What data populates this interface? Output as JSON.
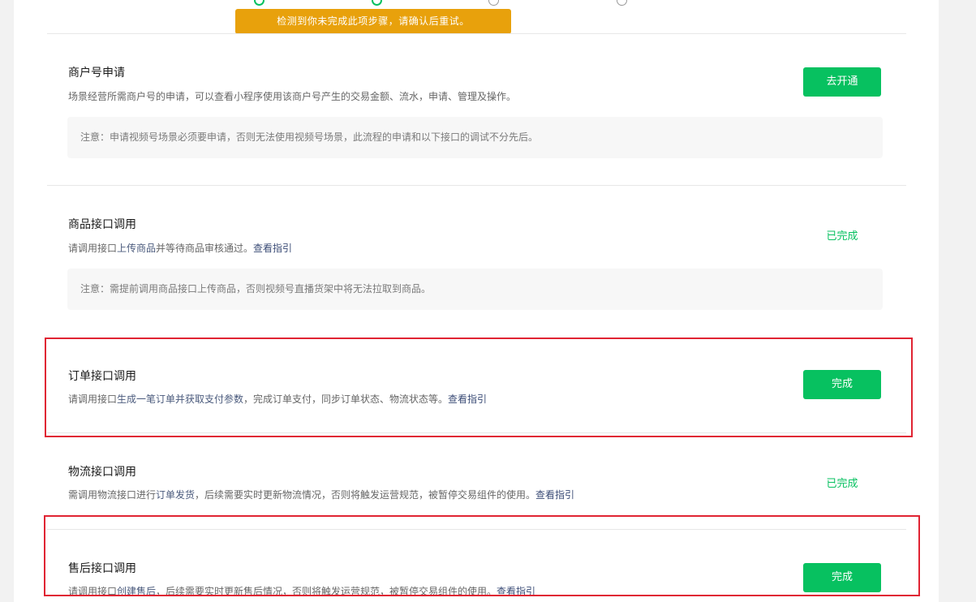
{
  "toast": {
    "message": "检测到你未完成此项步骤，请确认后重试。"
  },
  "sections": {
    "merchant": {
      "title": "商户号申请",
      "desc": "场景经营所需商户号的申请，可以查看小程序使用该商户号产生的交易金额、流水，申请、管理及操作。",
      "notice": "注意：申请视频号场景必须要申请，否则无法使用视频号场景，此流程的申请和以下接口的调试不分先后。",
      "action_label": "去开通"
    },
    "product": {
      "title": "商品接口调用",
      "desc_prefix": "请调用接口",
      "desc_keyword": "上传商品",
      "desc_suffix": "并等待商品审核通过。",
      "guide_link": "查看指引",
      "notice": "注意：需提前调用商品接口上传商品，否则视频号直播货架中将无法拉取到商品。",
      "status": "已完成"
    },
    "order": {
      "title": "订单接口调用",
      "desc_prefix": "请调用接口",
      "desc_keyword": "生成一笔订单并获取支付参数",
      "desc_suffix": "，完成订单支付，同步订单状态、物流状态等。",
      "guide_link": "查看指引",
      "action_label": "完成"
    },
    "logistics": {
      "title": "物流接口调用",
      "desc_prefix": "需调用物流接口进行",
      "desc_keyword": "订单发货",
      "desc_suffix": "，后续需要实时更新物流情况，否则将触发运营规范，被暂停交易组件的使用。",
      "guide_link": "查看指引",
      "status": "已完成"
    },
    "aftersale": {
      "title": "售后接口调用",
      "desc_prefix": "请调用接口",
      "desc_keyword": "创建售后",
      "desc_suffix": "，后续需要实时更新售后情况，否则将触发运营规范，被暂停交易组件的使用。",
      "guide_link": "查看指引",
      "action_label": "完成"
    }
  },
  "colors": {
    "primary": "#07c160",
    "warning": "#e8a10c",
    "highlight": "#e02433"
  }
}
